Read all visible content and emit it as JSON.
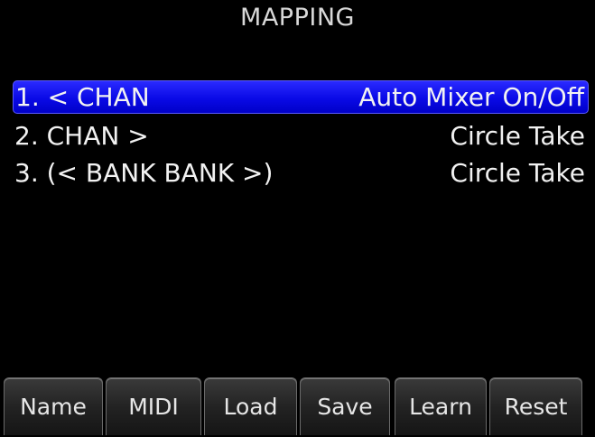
{
  "header": {
    "title": "MAPPING"
  },
  "mappings": [
    {
      "left": "1. < CHAN",
      "right": "Auto Mixer On/Off",
      "selected": true
    },
    {
      "left": "2. CHAN >",
      "right": "Circle Take",
      "selected": false
    },
    {
      "left": "3. (< BANK BANK >)",
      "right": "Circle Take",
      "selected": false
    }
  ],
  "toolbar": {
    "name_label": "Name",
    "midi_label": "MIDI",
    "load_label": "Load",
    "save_label": "Save",
    "learn_label": "Learn",
    "reset_label": "Reset"
  },
  "colors": {
    "background": "#000000",
    "selection": "#0a0ae6",
    "text": "#f2f2f2",
    "button": "#232323"
  }
}
